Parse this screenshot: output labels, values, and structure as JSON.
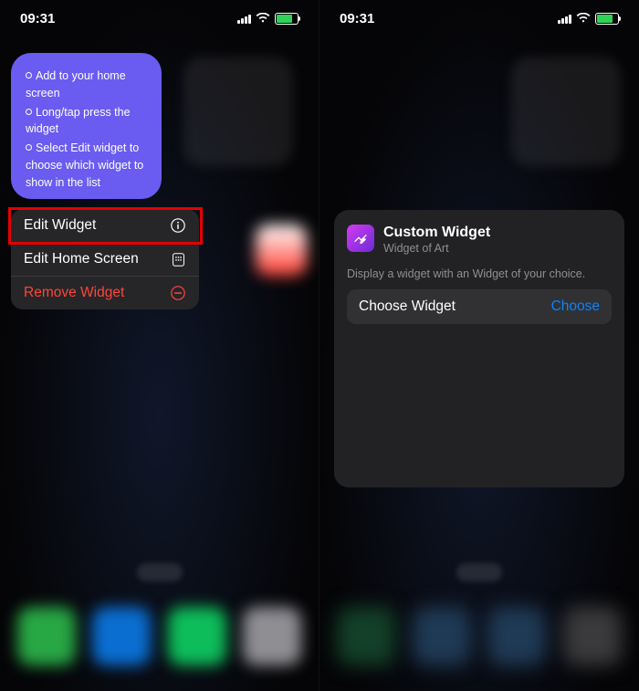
{
  "status": {
    "time": "09:31"
  },
  "left": {
    "tips": [
      "Add to your home screen",
      "Long/tap press the widget",
      "Select Edit widget to choose which widget to show in the list"
    ],
    "menu": {
      "edit_widget": "Edit Widget",
      "edit_home": "Edit Home Screen",
      "remove": "Remove Widget"
    }
  },
  "right": {
    "title": "Custom Widget",
    "subtitle": "Widget of Art",
    "description": "Display a widget with an Widget of your choice.",
    "row_label": "Choose Widget",
    "row_action": "Choose"
  }
}
